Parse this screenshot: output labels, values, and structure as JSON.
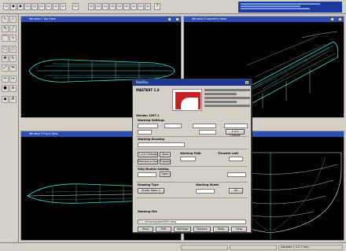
{
  "toolbar": {
    "icons": [
      "new-icon",
      "open-icon",
      "save-icon",
      "print-icon",
      "cut-icon",
      "copy-icon",
      "paste-icon",
      "undo-icon",
      "redo-icon",
      "help-icon"
    ],
    "title_glyph": "?"
  },
  "palette": {
    "icons": [
      "pointer-icon",
      "draw-icon",
      "pencil-icon",
      "line-icon",
      "arc-icon",
      "curve-icon",
      "rect-icon",
      "circle-icon",
      "move-icon",
      "rotate-icon",
      "scale-icon",
      "mirror-icon",
      "trim-icon",
      "extend-icon",
      "color-icon",
      "layer-icon"
    ]
  },
  "viewports": [
    {
      "name": "top-left",
      "title": "Window 1 Top View"
    },
    {
      "name": "top-right",
      "title": "Window 2 Isometric View"
    },
    {
      "name": "bottom-left",
      "title": "Window 3 Front View"
    },
    {
      "name": "bottom-right",
      "title": ""
    }
  ],
  "dialog": {
    "title": "RealYou",
    "close": "x",
    "app_name": "MASTERT 1.0",
    "version_label": "Version 1997.1",
    "working_settings": "Working Settings",
    "working_drawing": "Working Drawing",
    "working_path": "Working Path",
    "thruster_unit": "Thruster unit",
    "ship_models_setting": "Ship Models Setting",
    "drawing_type": "Drawing Type",
    "working_sheet": "Working Sheet",
    "working_file": "Working File",
    "buttons": {
      "change": "1.0.0 Change",
      "save": "Save",
      "restore": "Restore a File",
      "export": "Export",
      "open": "Open",
      "sheet": "Sheet Table 2",
      "ok": "OK",
      "bottom": [
        "Start",
        "Edit",
        "Settings",
        "Restore",
        "Note",
        "Help"
      ]
    },
    "path": "C:\\..\\drawing\\work\\file.dwg"
  },
  "status": {
    "cells": [
      "",
      "",
      "Solution 1 0 0 0 mm"
    ]
  },
  "colors": {
    "viewport_bg": "#000000",
    "wireframe": "#3ee0e0",
    "wireframe_white": "#e8e8e8",
    "title_bar": "#1b3a94",
    "logo_red": "#c62020"
  }
}
